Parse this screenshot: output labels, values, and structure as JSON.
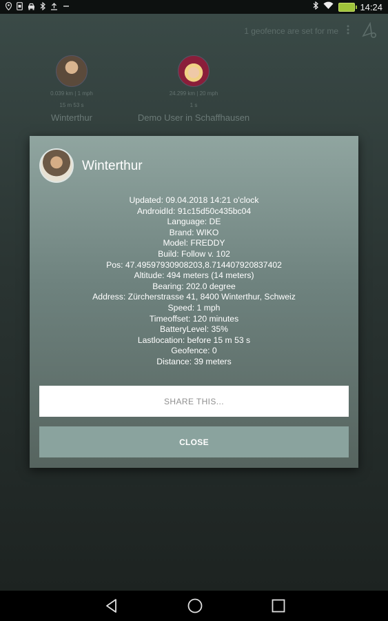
{
  "status_bar": {
    "left_icons": [
      "location-icon",
      "sim-icon",
      "car-icon",
      "bluetooth-icon",
      "upload-icon",
      "minus-icon"
    ],
    "right_icons": [
      "bluetooth-icon",
      "wifi-icon",
      "battery-icon"
    ],
    "time": "14:24",
    "battery_color": "#9fc43a"
  },
  "toolbar": {
    "geofence_text": "1 geofence are set for me",
    "more_icon": "more-vert-icon",
    "geofence_icon": "geofence-icon"
  },
  "users": [
    {
      "meta1": "0.039 km | 1 mph",
      "meta2": "15 m 53 s",
      "name": "Winterthur"
    },
    {
      "meta1": "24.299 km | 20 mph",
      "meta2": "1 s",
      "name": "Demo User in Schaffhausen"
    }
  ],
  "dialog": {
    "title": "Winterthur",
    "details": [
      "Updated: 09.04.2018 14:21 o'clock",
      "AndroidId: 91c15d50c435bc04",
      "Language: DE",
      "Brand: WIKO",
      "Model: FREDDY",
      "Build: Follow v. 102",
      "Pos: 47.49597930908203,8.714407920837402",
      "Altitude: 494 meters (14 meters)",
      "Bearing: 202.0 degree",
      "Address: Zürcherstrasse 41, 8400 Winterthur, Schweiz",
      "Speed: 1 mph",
      "Timeoffset: 120 minutes",
      "BatteryLevel: 35%",
      "Lastlocation: before 15 m 53 s",
      "Geofence: 0",
      "Distance: 39 meters"
    ],
    "share_label": "SHARE THIS...",
    "close_label": "CLOSE"
  },
  "nav_bar": {
    "icons": [
      "back-icon",
      "home-icon",
      "recents-icon"
    ]
  }
}
